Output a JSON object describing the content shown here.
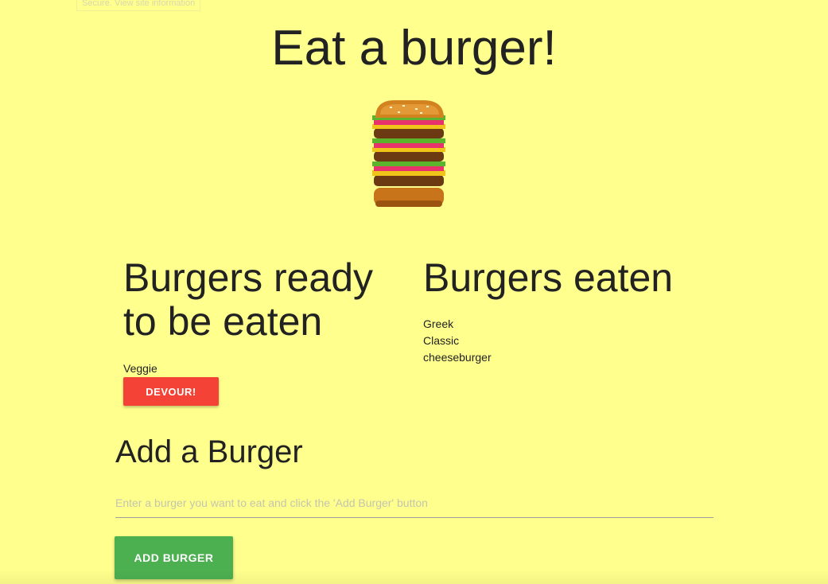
{
  "tooltip": "Secure. View site information",
  "page_title": "Eat a burger!",
  "image": {
    "icon": "burger-stack-pixel-art"
  },
  "ready": {
    "heading": "Burgers ready to be eaten",
    "items": [
      {
        "name": "Veggie",
        "button_label": "DEVOUR!"
      }
    ]
  },
  "eaten": {
    "heading": "Burgers eaten",
    "items": [
      "Greek",
      "Classic",
      "cheeseburger"
    ]
  },
  "add_form": {
    "heading": "Add a Burger",
    "input_value": "",
    "input_placeholder": "Enter a burger you want to eat and click the 'Add Burger' button",
    "button_label": "ADD BURGER"
  },
  "colors": {
    "background": "#ffff8d",
    "devour_button": "#f44336",
    "add_button": "#4caf50"
  }
}
